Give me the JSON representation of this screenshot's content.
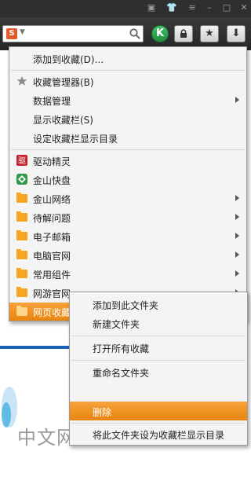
{
  "menu": {
    "items": [
      {
        "label": "添加到收藏(D)...",
        "icon": "none",
        "submenu": false
      },
      {
        "label": "收藏管理器(B)",
        "icon": "star-icon",
        "submenu": false
      },
      {
        "label": "数据管理",
        "icon": "none",
        "submenu": true
      },
      {
        "label": "显示收藏栏(S)",
        "icon": "none",
        "submenu": false
      },
      {
        "label": "设定收藏栏显示目录",
        "icon": "none",
        "submenu": false
      },
      {
        "label": "驱动精灵",
        "icon": "driver-genius-icon",
        "submenu": false
      },
      {
        "label": "金山快盘",
        "icon": "kingsoft-kuaipan-icon",
        "submenu": false
      },
      {
        "label": "金山网络",
        "icon": "folder-icon",
        "submenu": true
      },
      {
        "label": "待解问题",
        "icon": "folder-icon",
        "submenu": true
      },
      {
        "label": "电子邮箱",
        "icon": "folder-icon",
        "submenu": true
      },
      {
        "label": "电脑官网",
        "icon": "folder-icon",
        "submenu": true
      },
      {
        "label": "常用组件",
        "icon": "folder-icon",
        "submenu": true
      },
      {
        "label": "网游官网",
        "icon": "folder-icon",
        "submenu": true
      },
      {
        "label": "网页收藏",
        "icon": "folder-icon",
        "submenu": true,
        "highlighted": true
      }
    ]
  },
  "submenu": {
    "items": [
      {
        "label": "添加到此文件夹"
      },
      {
        "label": "新建文件夹"
      },
      {
        "label": "打开所有收藏"
      },
      {
        "label": "重命名文件夹"
      },
      {
        "label": "删除",
        "highlighted": true
      },
      {
        "label": "将此文件夹设为收藏栏显示目录"
      }
    ]
  },
  "toolbar": {
    "engine_badge": "S",
    "k_button": "K"
  },
  "background": {
    "page_text": "中文网"
  },
  "colors": {
    "highlight": "#f08f1c",
    "menu_bg": "#f4f4f4",
    "toolbar_bg": "#2f2f2f"
  }
}
